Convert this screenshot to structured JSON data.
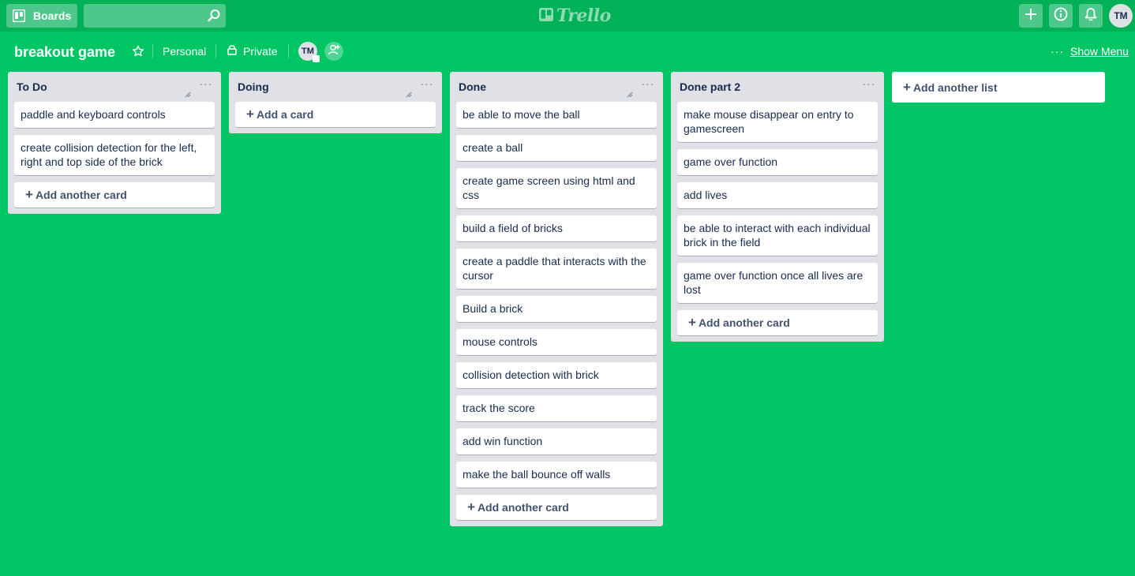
{
  "header": {
    "boards_label": "Boards",
    "search_value": "",
    "logo_text": "Trello",
    "user_initials": "TM"
  },
  "board": {
    "title": "breakout game",
    "team": "Personal",
    "visibility": "Private",
    "member_initials": "TM",
    "show_menu_label": "Show Menu",
    "dots": "···"
  },
  "lists": [
    {
      "title": "To Do",
      "cards": [
        "paddle and keyboard controls",
        "create collision detection for the left, right and top side of the brick"
      ],
      "add_label": "Add another card"
    },
    {
      "title": "Doing",
      "cards": [],
      "add_label": "Add a card"
    },
    {
      "title": "Done",
      "cards": [
        "be able to move the ball",
        "create a ball",
        "create game screen using html and css",
        "build a field of bricks",
        "create a paddle that interacts with the cursor",
        "Build a brick",
        "mouse controls",
        "collision detection with brick",
        "track the score",
        "add win function",
        "make the ball bounce off walls"
      ],
      "add_label": "Add another card"
    },
    {
      "title": "Done part 2",
      "cards": [
        "make mouse disappear on entry to gamescreen",
        "game over function",
        "add lives",
        "be able to interact with each individual brick in the field",
        "game over function once all lives are lost"
      ],
      "add_label": "Add another card"
    }
  ],
  "add_list_label": "Add another list",
  "colors": {
    "board_bg": "#00c565",
    "header_bg": "#00b158",
    "list_bg": "#dfe1e6"
  }
}
